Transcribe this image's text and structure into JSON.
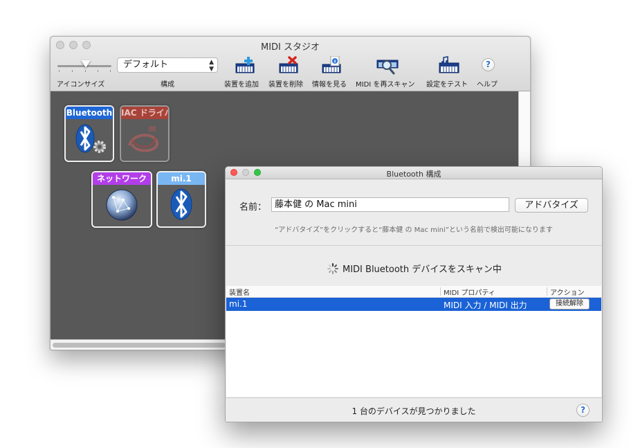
{
  "main_window": {
    "title": "MIDI スタジオ",
    "icon_size_label": "アイコンサイズ",
    "config_select_value": "デフォルト",
    "config_label": "構成",
    "toolbar": {
      "add_device": "装置を追加",
      "remove_device": "装置を削除",
      "show_info": "情報を見る",
      "rescan": "MIDI を再スキャン",
      "test_setup": "設定をテスト",
      "help": "ヘルプ",
      "help_glyph": "?"
    },
    "devices": [
      {
        "name": "Bluetooth",
        "header_color": "#1f67d6",
        "icon": "bluetooth-gear-icon"
      },
      {
        "name": "IAC ドライバ",
        "header_color": "#a8433a",
        "icon": "midi-cable-icon"
      },
      {
        "name": "ネットワーク",
        "header_color": "#b23ee8",
        "icon": "network-globe-icon"
      },
      {
        "name": "mi.1",
        "header_color": "#79b7f3",
        "icon": "bluetooth-icon"
      }
    ]
  },
  "bt_window": {
    "title": "Bluetooth 構成",
    "name_label": "名前：",
    "name_value": "藤本健 の Mac mini",
    "advertise_button": "アドバタイズ",
    "hint": "“アドバタイズ”をクリックすると“藤本健 の Mac mini”という名前で検出可能になります",
    "scan_status": "MIDI Bluetooth デバイスをスキャン中",
    "columns": {
      "device": "装置名",
      "midi": "MIDI プロパティ",
      "action": "アクション"
    },
    "rows": [
      {
        "device": "mi.1",
        "midi": "MIDI 入力 / MIDI 出力",
        "action": "接続解除"
      }
    ],
    "footer_status": "1 台のデバイスが見つかりました",
    "help_glyph": "?",
    "accent_color": "#1a62d6"
  }
}
